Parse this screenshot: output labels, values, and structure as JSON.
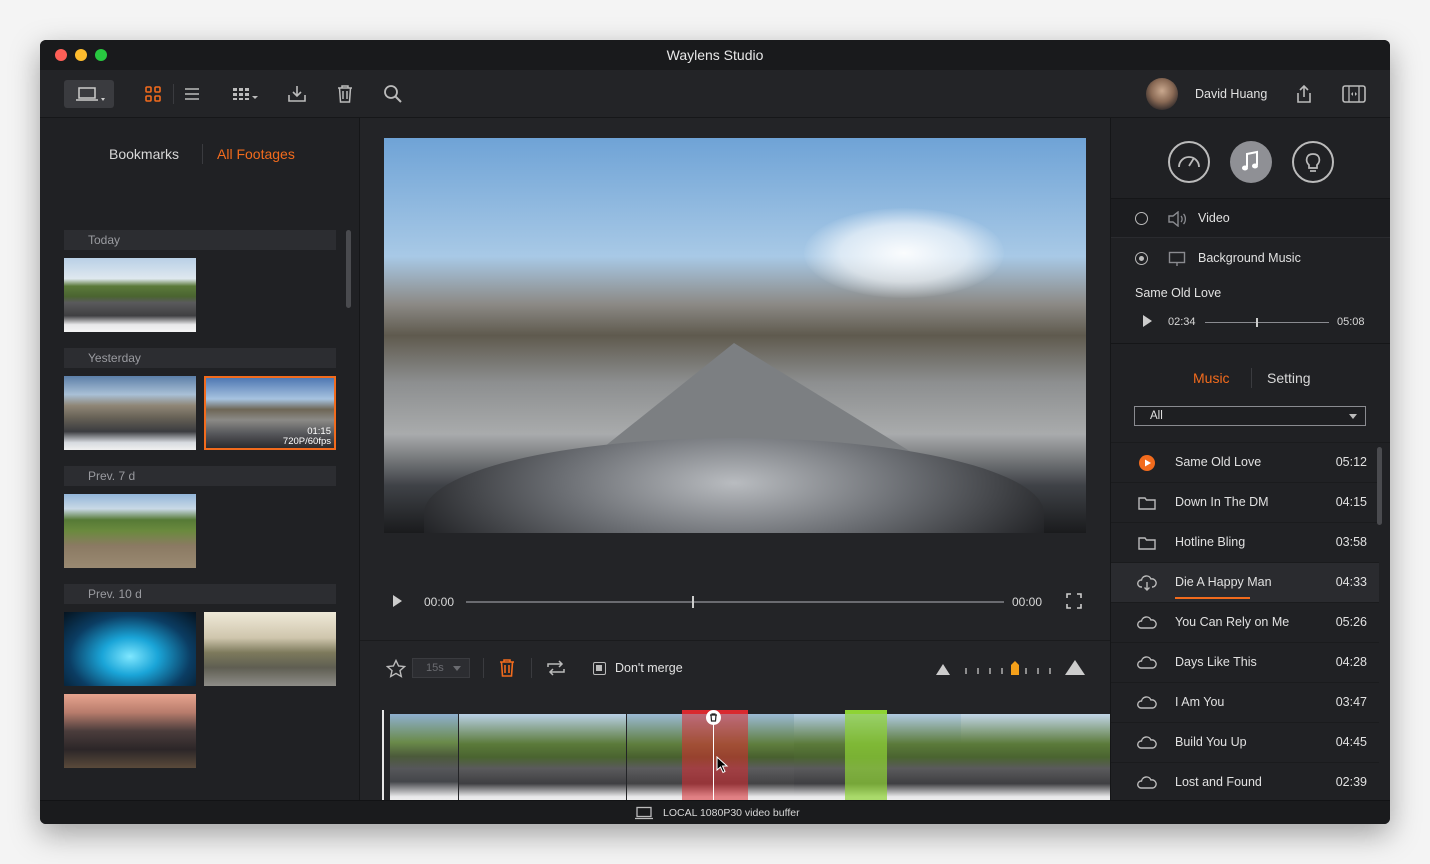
{
  "app": {
    "title": "Waylens Studio"
  },
  "user": {
    "name": "David Huang"
  },
  "library_tabs": {
    "bookmarks": "Bookmarks",
    "all_footages": "All Footages"
  },
  "sections": [
    {
      "label": "Today"
    },
    {
      "label": "Yesterday"
    },
    {
      "label": "Prev. 7 d"
    },
    {
      "label": "Prev. 10 d"
    }
  ],
  "selected_thumb": {
    "duration": "01:15",
    "format": "720P/60fps"
  },
  "player": {
    "current_time": "00:00",
    "end_time": "00:00",
    "progress": 0.42
  },
  "edit_toolbar": {
    "clip_length": "15s",
    "merge_label": "Don't merge"
  },
  "audio": {
    "video_label": "Video",
    "bg_music_label": "Background Music",
    "track_name": "Same Old Love",
    "elapsed": "02:34",
    "total": "05:08",
    "progress": 0.41
  },
  "music_tabs": {
    "music": "Music",
    "setting": "Setting"
  },
  "filter": {
    "selected": "All"
  },
  "tracks": [
    {
      "name": "Same Old Love",
      "duration": "05:12",
      "icon": "play-circle-icon"
    },
    {
      "name": "Down In The DM",
      "duration": "04:15",
      "icon": "folder-icon"
    },
    {
      "name": "Hotline Bling",
      "duration": "03:58",
      "icon": "folder-icon"
    },
    {
      "name": "Die A Happy Man",
      "duration": "04:33",
      "icon": "cloud-download-icon",
      "download_progress": 0.45
    },
    {
      "name": "You Can Rely on Me",
      "duration": "05:26",
      "icon": "cloud-icon"
    },
    {
      "name": "Days Like This",
      "duration": "04:28",
      "icon": "cloud-icon"
    },
    {
      "name": "I Am You",
      "duration": "03:47",
      "icon": "cloud-icon"
    },
    {
      "name": "Build You Up",
      "duration": "04:45",
      "icon": "cloud-icon"
    },
    {
      "name": "Lost and Found",
      "duration": "02:39",
      "icon": "cloud-icon"
    }
  ],
  "status": {
    "text": "LOCAL 1080P30 video buffer"
  },
  "colors": {
    "accent": "#f26b1d",
    "delete_region": "#d9292f",
    "highlight_region": "#8ed334",
    "background": "#1e1f22"
  }
}
